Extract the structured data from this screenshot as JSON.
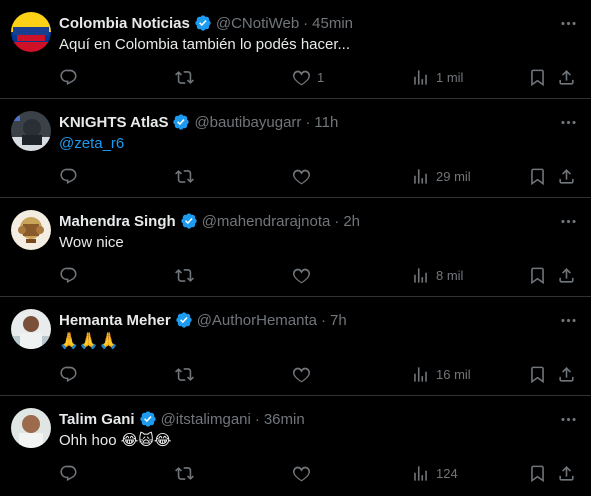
{
  "icons": {
    "verified": "verified-badge-icon",
    "more": "more-horizontal-icon",
    "reply": "reply-icon",
    "retweet": "retweet-icon",
    "like": "heart-icon",
    "views": "views-bar-chart-icon",
    "bookmark": "bookmark-icon",
    "share": "share-icon"
  },
  "colors": {
    "background": "#000000",
    "text": "#e7e9ea",
    "muted": "#71767b",
    "link": "#1d9bf0",
    "verified": "#1d9bf0",
    "divider": "#2f3336"
  },
  "tweets": [
    {
      "name": "Colombia Noticias",
      "handle": "@CNotiWeb",
      "separator": "·",
      "time": "45min",
      "text": "Aquí en Colombia también lo podés hacer...",
      "replies": "",
      "retweets": "",
      "likes": "1",
      "views": "1 mil"
    },
    {
      "name": "KNIGHTS AtlaS",
      "handle": "@bautibayugarr",
      "separator": "·",
      "time": "11h",
      "text": "@zeta_r6",
      "replies": "",
      "retweets": "",
      "likes": "",
      "views": "29 mil"
    },
    {
      "name": "Mahendra Singh",
      "handle": "@mahendrarajnota",
      "separator": "·",
      "time": "2h",
      "text": "Wow nice",
      "replies": "",
      "retweets": "",
      "likes": "",
      "views": "8 mil"
    },
    {
      "name": "Hemanta Meher",
      "handle": "@AuthorHemanta",
      "separator": "·",
      "time": "7h",
      "text": "🙏🙏🙏",
      "replies": "",
      "retweets": "",
      "likes": "",
      "views": "16 mil"
    },
    {
      "name": "Talim Gani",
      "handle": "@itstalimgani",
      "separator": "·",
      "time": "36min",
      "text": "Ohh hoo 😂🙀😂",
      "replies": "",
      "retweets": "",
      "likes": "",
      "views": "124"
    }
  ]
}
